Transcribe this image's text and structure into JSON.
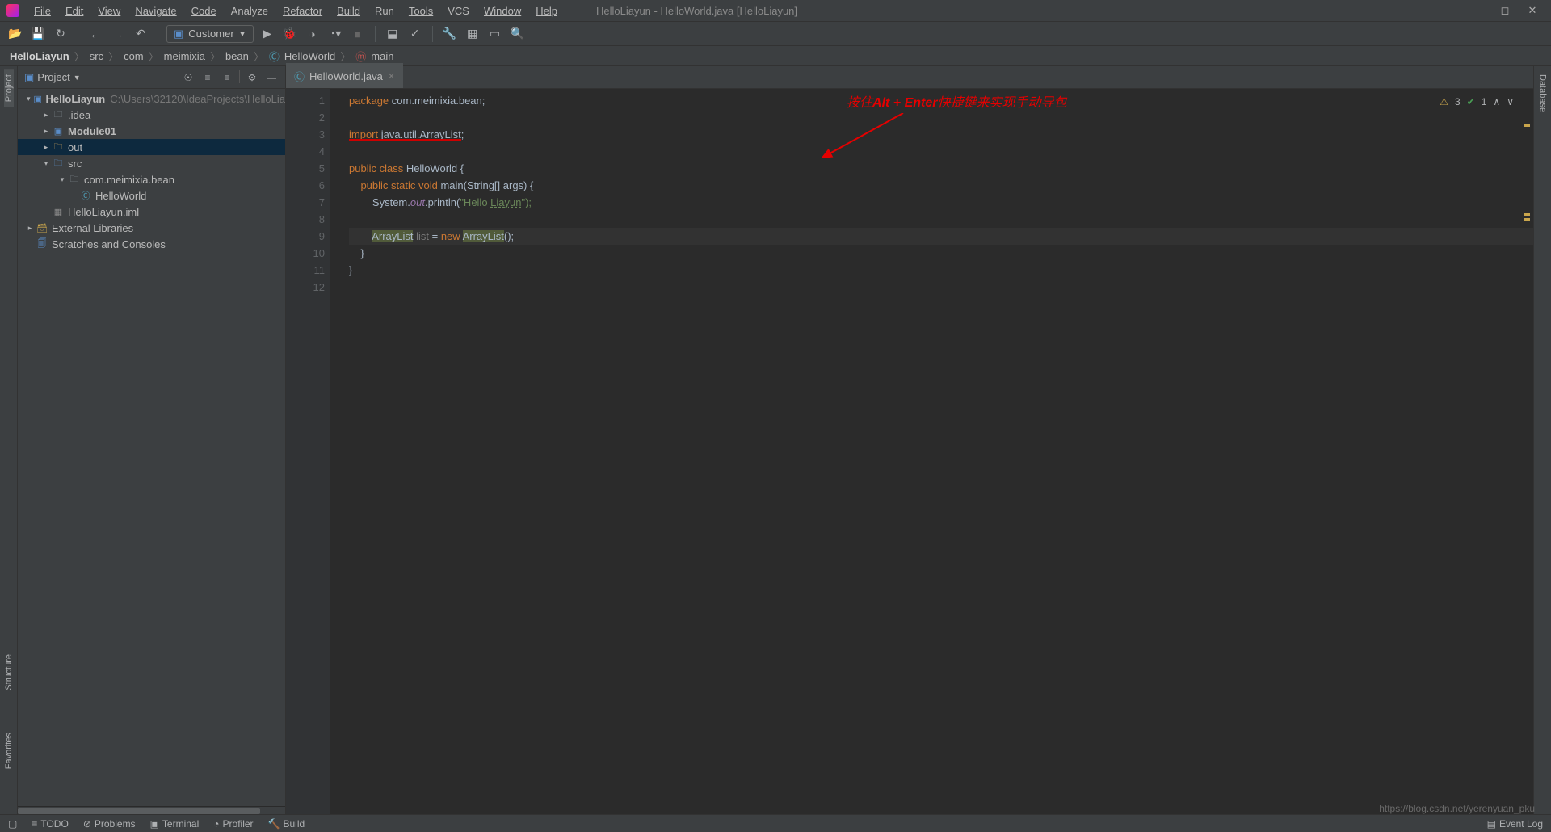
{
  "window": {
    "title": "HelloLiayun - HelloWorld.java [HelloLiayun]"
  },
  "menus": [
    "File",
    "Edit",
    "View",
    "Navigate",
    "Code",
    "Analyze",
    "Refactor",
    "Build",
    "Run",
    "Tools",
    "VCS",
    "Window",
    "Help"
  ],
  "runConfig": "Customer",
  "breadcrumbs": [
    "HelloLiayun",
    "src",
    "com",
    "meimixia",
    "bean",
    "HelloWorld",
    "main"
  ],
  "project": {
    "title": "Project",
    "root": {
      "name": "HelloLiayun",
      "path": "C:\\Users\\32120\\IdeaProjects\\HelloLia"
    },
    "nodes": [
      {
        "name": ".idea",
        "indent": 2,
        "icon": "folder-g",
        "arrow": ">"
      },
      {
        "name": "Module01",
        "indent": 2,
        "icon": "folder-b",
        "arrow": ">"
      },
      {
        "name": "out",
        "indent": 2,
        "icon": "folder-y",
        "arrow": ">",
        "sel": true
      },
      {
        "name": "src",
        "indent": 2,
        "icon": "folder-b",
        "arrow": "v"
      },
      {
        "name": "com.meimixia.bean",
        "indent": 3,
        "icon": "folder-g",
        "arrow": "v"
      },
      {
        "name": "HelloWorld",
        "indent": 4,
        "icon": "file-c",
        "arrow": ""
      },
      {
        "name": "HelloLiayun.iml",
        "indent": 2,
        "icon": "file-c",
        "arrow": ""
      }
    ],
    "extLib": "External Libraries",
    "scratches": "Scratches and Consoles"
  },
  "leftTabs": [
    "Project",
    "Structure",
    "Favorites"
  ],
  "rightTabs": [
    "Database"
  ],
  "editorTab": "HelloWorld.java",
  "annotation": {
    "prefix": "按住",
    "key": "Alt + Enter",
    "suffix": "快捷键来实现手动导包"
  },
  "code": {
    "l1": {
      "kw": "package",
      "rest": " com.meimixia.bean;"
    },
    "l3": {
      "kw": "import",
      "rest": " java.util.ArrayList",
      "semi": ";"
    },
    "l5": {
      "pub": "public class ",
      "cls": "HelloWorld",
      "br": " {"
    },
    "l6": {
      "mods": "public static void ",
      "name": "main",
      "args": "(String[] args) {"
    },
    "l7": {
      "sys": "System.",
      "out": "out",
      "pr": ".println(",
      "str": "\"Hello ",
      "li": "Liayun",
      "end": "\");"
    },
    "l9": {
      "al1": "ArrayList",
      "var": " list",
      "eq": " = ",
      "nw": "new ",
      "al2": "ArrayList",
      "p": "();"
    },
    "l10": "    }",
    "l11": "}"
  },
  "lineNumbers": [
    "1",
    "2",
    "3",
    "4",
    "5",
    "6",
    "7",
    "8",
    "9",
    "10",
    "11",
    "12"
  ],
  "inspections": {
    "warn": "3",
    "ok": "1"
  },
  "statusItems": [
    "TODO",
    "Problems",
    "Terminal",
    "Profiler",
    "Build"
  ],
  "eventLog": "Event Log",
  "watermark": "https://blog.csdn.net/yerenyuan_pku"
}
